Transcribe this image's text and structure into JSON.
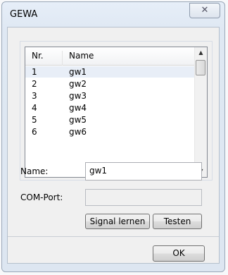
{
  "window": {
    "title": "GEWA",
    "close_glyph": "✕"
  },
  "list": {
    "columns": [
      "Nr.",
      "Name"
    ],
    "rows": [
      {
        "nr": "1",
        "name": "gw1"
      },
      {
        "nr": "2",
        "name": "gw2"
      },
      {
        "nr": "3",
        "name": "gw3"
      },
      {
        "nr": "4",
        "name": "gw4"
      },
      {
        "nr": "5",
        "name": "gw5"
      },
      {
        "nr": "6",
        "name": "gw6"
      }
    ],
    "selected_row": 0,
    "scroll_up_glyph": "▲",
    "scroll_down_glyph": "▼"
  },
  "form": {
    "name_label": "Name:",
    "name_value": "gw1",
    "com_label": "COM-Port:",
    "com_value": ""
  },
  "buttons": {
    "signal": "Signal lernen",
    "test": "Testen",
    "ok": "OK"
  }
}
